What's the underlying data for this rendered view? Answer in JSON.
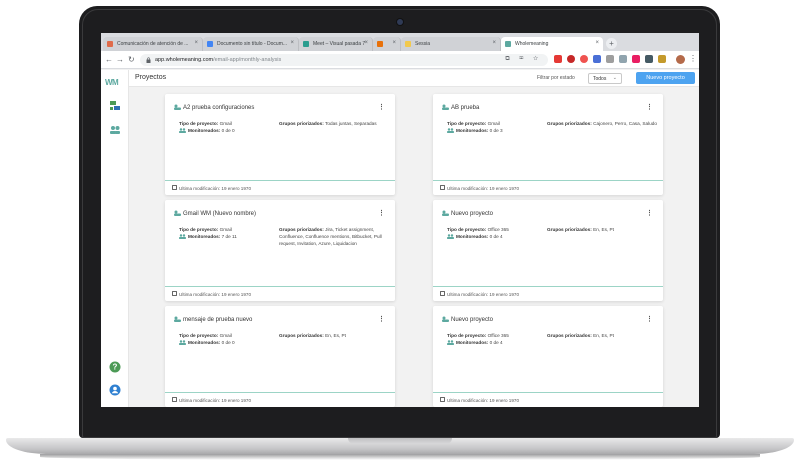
{
  "browser": {
    "tabs": [
      {
        "label": "Comunicación de atención de ...",
        "color": "#e06b4a"
      },
      {
        "label": "Documento sin título - Docum...",
        "color": "#4285f4"
      },
      {
        "label": "Meet – Visual pasada 7",
        "color": "#2a9d8f"
      },
      {
        "label": "",
        "color": "#e8710a"
      },
      {
        "label": "Sessia",
        "color": "#f2c94c"
      },
      {
        "label": "Wholemeaning",
        "color": "#5da9a0"
      }
    ],
    "url_host": "app.wholemeaning.com",
    "url_path": "/email-app/monthly-analysis"
  },
  "app": {
    "logo": "WM",
    "header_title": "Proyectos",
    "filter_label": "Filtrar por estado",
    "filter_value": "Todos",
    "new_button": "Nuevo proyecto",
    "accent": "#5da9a0",
    "button_color": "#4da3f0"
  },
  "labels": {
    "tipo": "Tipo de proyecto:",
    "monitoreados": "Monitoreados:",
    "grupos": "Grupos priorizados:",
    "ultima": "Ultima modificación:"
  },
  "cards": [
    {
      "name": "A2 prueba configuraciones",
      "tipo": "Gmail",
      "monitoreados": "0 de 0",
      "grupos": "Todas juntas, Separadas",
      "modificacion": "19 enero 1970"
    },
    {
      "name": "AB prueba",
      "tipo": "Gmail",
      "monitoreados": "0 de 3",
      "grupos": "Cajonero, Perro, Casa, Saludo",
      "modificacion": "19 enero 1970"
    },
    {
      "name": "Gmail WM (Nuevo nombre)",
      "tipo": "Gmail",
      "monitoreados": "7 de 11",
      "grupos": "Jira, Ticket assignment, Confluence, Confluence mentions, Bitbucket, Pull request, Invitation, Azure, Liquidacion",
      "modificacion": "19 enero 1970"
    },
    {
      "name": "Nuevo proyecto",
      "tipo": "Office 365",
      "monitoreados": "0 de 4",
      "grupos": "En, Es, Pt",
      "modificacion": "19 enero 1970"
    },
    {
      "name": "mensaje de prueba nuevo",
      "tipo": "Gmail",
      "monitoreados": "0 de 0",
      "grupos": "En, Es, Pt",
      "modificacion": "19 enero 1970"
    },
    {
      "name": "Nuevo proyecto",
      "tipo": "Office 365",
      "monitoreados": "0 de 4",
      "grupos": "En, Es, Pt",
      "modificacion": "19 enero 1970"
    }
  ]
}
